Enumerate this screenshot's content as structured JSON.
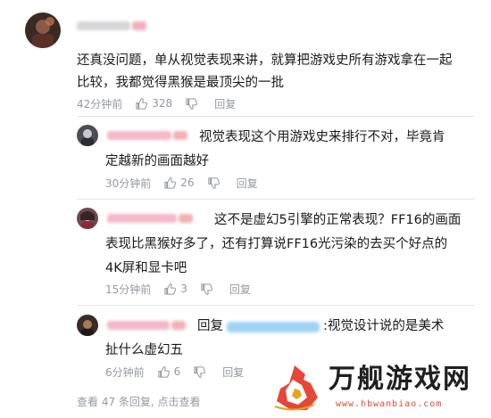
{
  "main_comment": {
    "text_line1": "还真没问题，单从视觉表现来讲，就算把游戏史所有游戏拿在一起",
    "text_line2": "比较，我都觉得黑猴是最顶尖的一批",
    "time": "42分钟前",
    "likes": "328",
    "reply_label": "回复"
  },
  "replies": [
    {
      "text_line1": "视觉表现这个用游戏史来排行不对，毕竟肯",
      "text_line2": "定越新的画面越好",
      "time": "30分钟前",
      "likes": "26",
      "reply_label": "回复"
    },
    {
      "text_line1": "这不是虚幻5引擎的正常表现？FF16的画面",
      "text_line2": "表现比黑猴好多了，还有打算说FF16光污染的去买个好点的",
      "text_line3": "4K屏和显卡吧",
      "time": "15分钟前",
      "likes": "3",
      "reply_label": "回复"
    },
    {
      "prefix": "回复",
      "text_line1": ":视觉设计说的是美术",
      "text_line2": "扯什么虚幻五",
      "time": "6分钟前",
      "likes": "6",
      "reply_label": "回复"
    }
  ],
  "footer": {
    "view_more": "查看 47 条回复, 点击查看"
  },
  "watermark": {
    "title": "万舰游戏网",
    "url": "www.hbwanbiao.com",
    "accent_color": "#e4483a"
  },
  "colors": {
    "meta_text": "#9499a0",
    "name_blur_pink": "#f5b3c4",
    "mention_blur_blue": "#8ec9f2"
  }
}
